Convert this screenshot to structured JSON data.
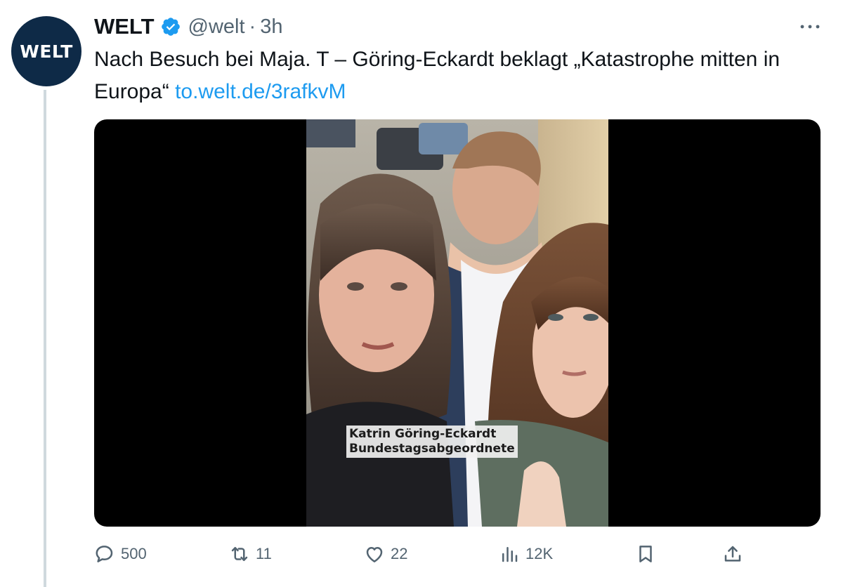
{
  "account": {
    "avatar_text": "WELT",
    "display_name": "WELT",
    "handle": "@welt",
    "separator": "·",
    "time": "3h"
  },
  "tweet": {
    "text": "Nach Besuch bei Maja. T – Göring-Eckardt beklagt „Katastrophe mitten in Europa“ ",
    "link": "to.welt.de/3rafkvM"
  },
  "media": {
    "caption_name": "Katrin Göring-Eckardt",
    "caption_title": "Bundestagsabgeordnete"
  },
  "actions": {
    "replies": "500",
    "retweets": "11",
    "likes": "22",
    "views": "12K"
  },
  "colors": {
    "link": "#1d9bf0",
    "verified": "#1d9bf0",
    "avatar_bg": "#0e2a47",
    "secondary_text": "#536471"
  },
  "icons": {
    "verified": "verified-badge-icon",
    "more": "more-dots-icon",
    "reply": "reply-bubble-icon",
    "retweet": "retweet-arrows-icon",
    "like": "heart-icon",
    "views": "bar-chart-icon",
    "bookmark": "bookmark-icon",
    "share": "share-upload-icon"
  }
}
